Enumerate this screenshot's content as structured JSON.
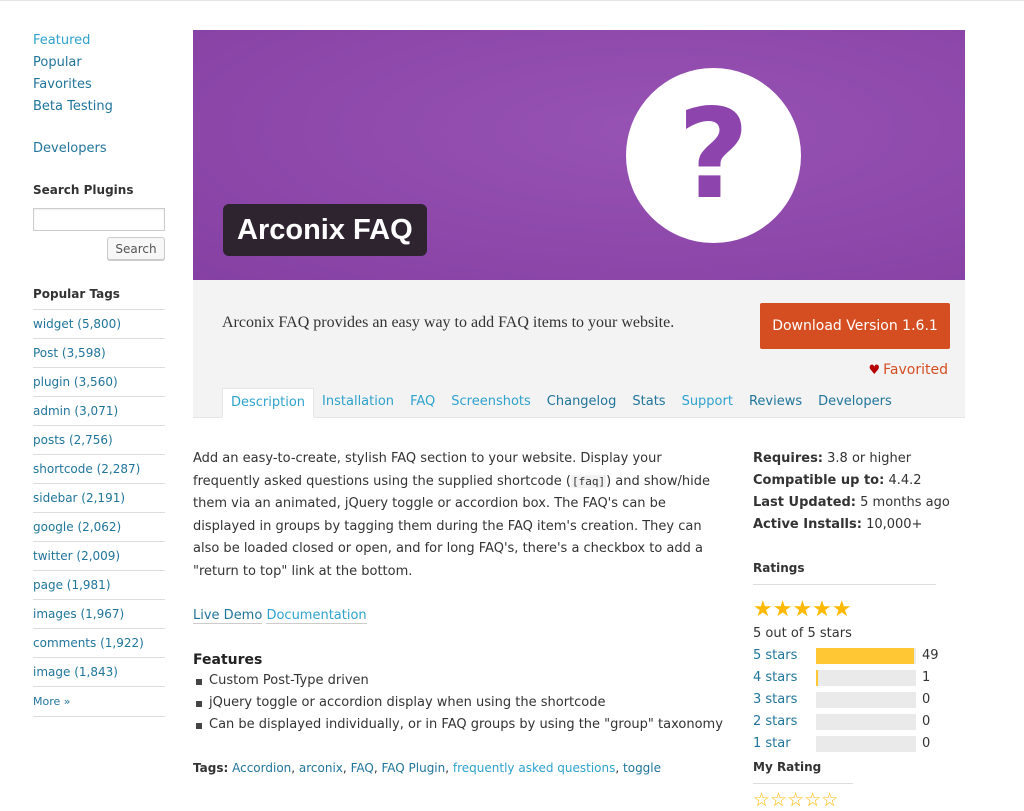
{
  "sidebar": {
    "nav": [
      {
        "label": "Featured"
      },
      {
        "label": "Popular"
      },
      {
        "label": "Favorites"
      },
      {
        "label": "Beta Testing"
      }
    ],
    "developers": "Developers",
    "search_heading": "Search Plugins",
    "search_value": "",
    "search_button": "Search",
    "tags_heading": "Popular Tags",
    "tags": [
      "widget (5,800)",
      "Post (3,598)",
      "plugin (3,560)",
      "admin (3,071)",
      "posts (2,756)",
      "shortcode (2,287)",
      "sidebar (2,191)",
      "google (2,062)",
      "twitter (2,009)",
      "page (1,981)",
      "images (1,967)",
      "comments (1,922)",
      "image (1,843)"
    ],
    "more": "More »"
  },
  "banner": {
    "title": "Arconix FAQ",
    "icon_glyph": "?",
    "bg_color": "#8e44ad"
  },
  "header": {
    "short_description": "Arconix FAQ provides an easy way to add FAQ items to your website.",
    "download_label": "Download Version 1.6.1",
    "favorited_label": "Favorited",
    "tabs": [
      {
        "label": "Description"
      },
      {
        "label": "Installation"
      },
      {
        "label": "FAQ"
      },
      {
        "label": "Screenshots"
      },
      {
        "label": "Changelog"
      },
      {
        "label": "Stats"
      },
      {
        "label": "Support"
      },
      {
        "label": "Reviews"
      },
      {
        "label": "Developers"
      }
    ]
  },
  "description": {
    "text_before": "Add an easy-to-create, stylish FAQ section to your website. Display your frequently asked questions using the supplied shortcode (",
    "code": "[faq]",
    "text_after": ") and show/hide them via an animated, jQuery toggle or accordion box. The FAQ's can be displayed in groups by tagging them during the FAQ item's creation. They can also be loaded closed or open, and for long FAQ's, there's a checkbox to add a \"return to top\" link at the bottom.",
    "link_demo": "Live Demo",
    "link_docs": "Documentation",
    "features_heading": "Features",
    "features": [
      "Custom Post-Type driven",
      "jQuery toggle or accordion display when using the shortcode",
      "Can be displayed individually, or in FAQ groups by using the \"group\" taxonomy"
    ],
    "tags_label": "Tags:",
    "tags": [
      "Accordion",
      "arconix",
      "FAQ",
      "FAQ Plugin",
      "frequently asked questions",
      "toggle"
    ]
  },
  "meta": {
    "requires_label": "Requires:",
    "requires_value": "3.8 or higher",
    "compatible_label": "Compatible up to:",
    "compatible_value": "4.4.2",
    "updated_label": "Last Updated:",
    "updated_value": "5 months ago",
    "installs_label": "Active Installs:",
    "installs_value": "10,000+",
    "ratings_heading": "Ratings",
    "stars_display": "★★★★★",
    "rating_text": "5 out of 5 stars",
    "rating_bars": [
      {
        "label": "5 stars",
        "count": "49",
        "fraction": 0.98
      },
      {
        "label": "4 stars",
        "count": "1",
        "fraction": 0.02
      },
      {
        "label": "3 stars",
        "count": "0",
        "fraction": 0
      },
      {
        "label": "2 stars",
        "count": "0",
        "fraction": 0
      },
      {
        "label": "1 star",
        "count": "0",
        "fraction": 0
      }
    ],
    "my_rating_heading": "My Rating",
    "my_rating_stars": "☆☆☆☆☆"
  },
  "colors": {
    "link": "#21759b",
    "link_light": "#2ea2cc",
    "download": "#d54e21",
    "star": "#ffb900",
    "bar_fill": "#ffc733"
  }
}
